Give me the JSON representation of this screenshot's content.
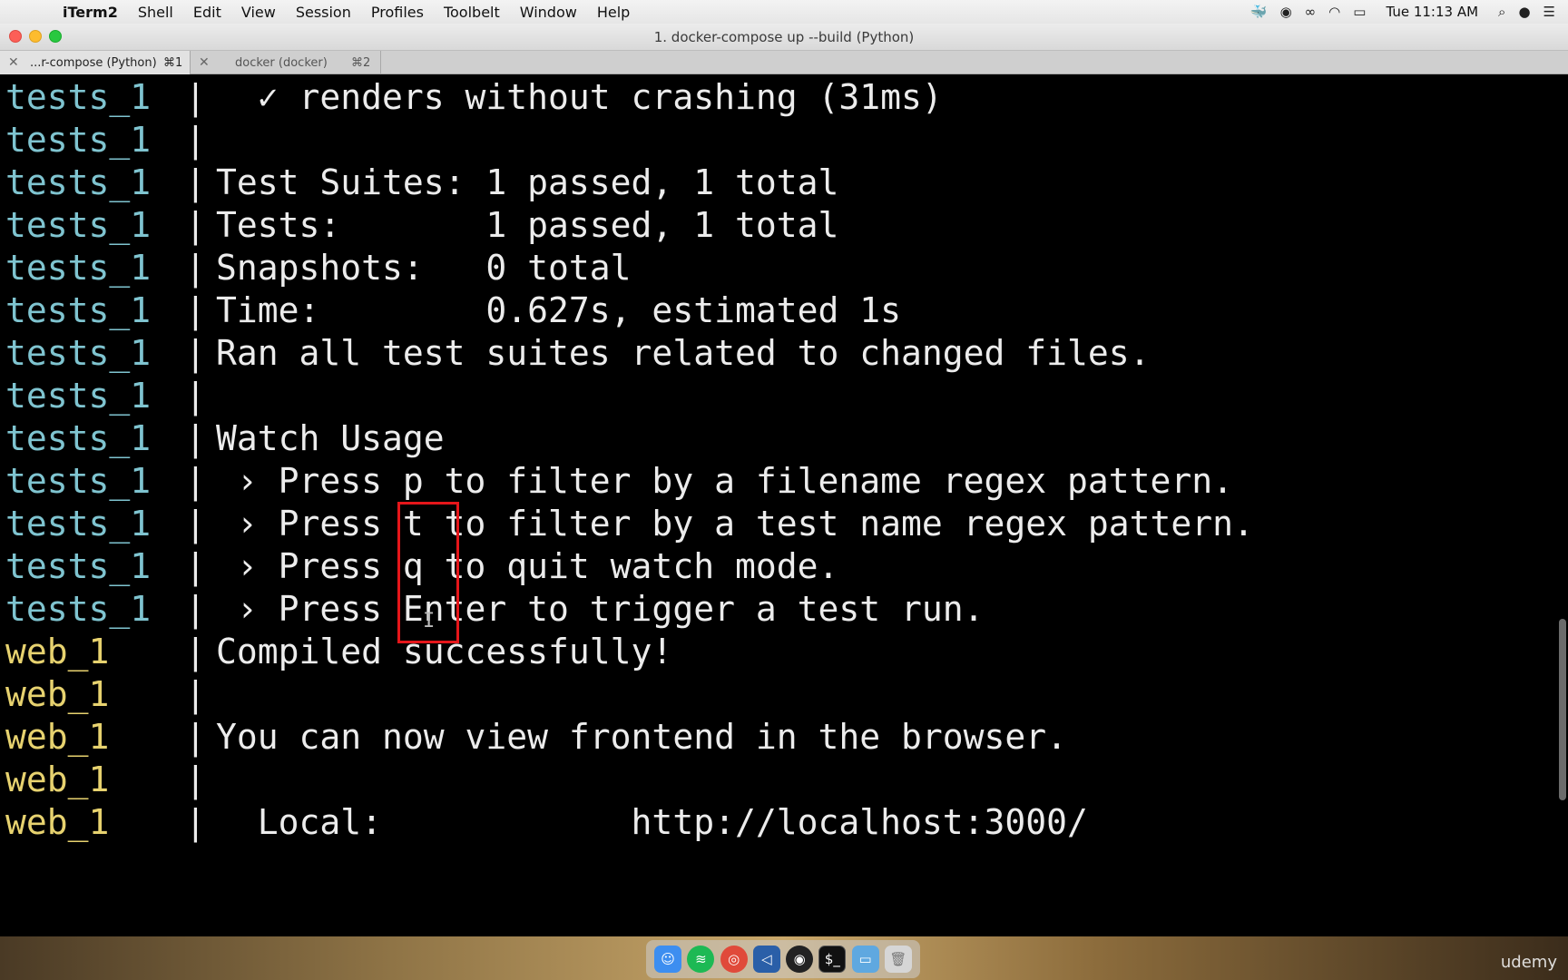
{
  "menubar": {
    "apple_glyph": "",
    "items": [
      "iTerm2",
      "Shell",
      "Edit",
      "View",
      "Session",
      "Profiles",
      "Toolbelt",
      "Window",
      "Help"
    ],
    "clock": "Tue 11:13 AM",
    "status_icons": [
      "docker-icon",
      "obs-icon",
      "glasses-icon",
      "wifi-icon",
      "battery-icon",
      "spotlight-icon",
      "siri-icon",
      "notification-center-icon"
    ]
  },
  "window": {
    "title": "1. docker-compose up --build (Python)"
  },
  "tabs": [
    {
      "label": "...r-compose (Python)",
      "shortcut": "⌘1",
      "close": "✕"
    },
    {
      "label": "docker (docker)",
      "shortcut": "⌘2",
      "close": "✕"
    }
  ],
  "colors": {
    "tests_service": "#7fc4d0",
    "web_service": "#e7d26f",
    "highlight_box": "#e5161a",
    "terminal_bg": "#000000"
  },
  "terminal": {
    "lines": [
      {
        "service": "tests_1",
        "sep": "|",
        "text": "  ✓ renders without crashing (31ms)"
      },
      {
        "service": "tests_1",
        "sep": "|",
        "text": ""
      },
      {
        "service": "tests_1",
        "sep": "|",
        "text": "Test Suites: 1 passed, 1 total"
      },
      {
        "service": "tests_1",
        "sep": "|",
        "text": "Tests:       1 passed, 1 total"
      },
      {
        "service": "tests_1",
        "sep": "|",
        "text": "Snapshots:   0 total"
      },
      {
        "service": "tests_1",
        "sep": "|",
        "text": "Time:        0.627s, estimated 1s"
      },
      {
        "service": "tests_1",
        "sep": "|",
        "text": "Ran all test suites related to changed files."
      },
      {
        "service": "tests_1",
        "sep": "|",
        "text": ""
      },
      {
        "service": "tests_1",
        "sep": "|",
        "text": "Watch Usage"
      },
      {
        "service": "tests_1",
        "sep": "|",
        "text": " › Press p to filter by a filename regex pattern."
      },
      {
        "service": "tests_1",
        "sep": "|",
        "text": " › Press t to filter by a test name regex pattern."
      },
      {
        "service": "tests_1",
        "sep": "|",
        "text": " › Press q to quit watch mode."
      },
      {
        "service": "tests_1",
        "sep": "|",
        "text": " › Press Enter to trigger a test run."
      },
      {
        "service": "web_1",
        "sep": "|",
        "text": "Compiled successfully!"
      },
      {
        "service": "web_1",
        "sep": "|",
        "text": ""
      },
      {
        "service": "web_1",
        "sep": "|",
        "text": "You can now view frontend in the browser."
      },
      {
        "service": "web_1",
        "sep": "|",
        "text": ""
      },
      {
        "service": "web_1",
        "sep": "|",
        "text": "  Local:            http://localhost:3000/"
      }
    ]
  },
  "dock": {
    "icons": [
      "finder-icon",
      "spotify-icon",
      "chrome-icon",
      "vscode-icon",
      "obs-icon",
      "terminal-icon",
      "folder-icon",
      "trash-icon"
    ]
  },
  "watermark": "udemy"
}
